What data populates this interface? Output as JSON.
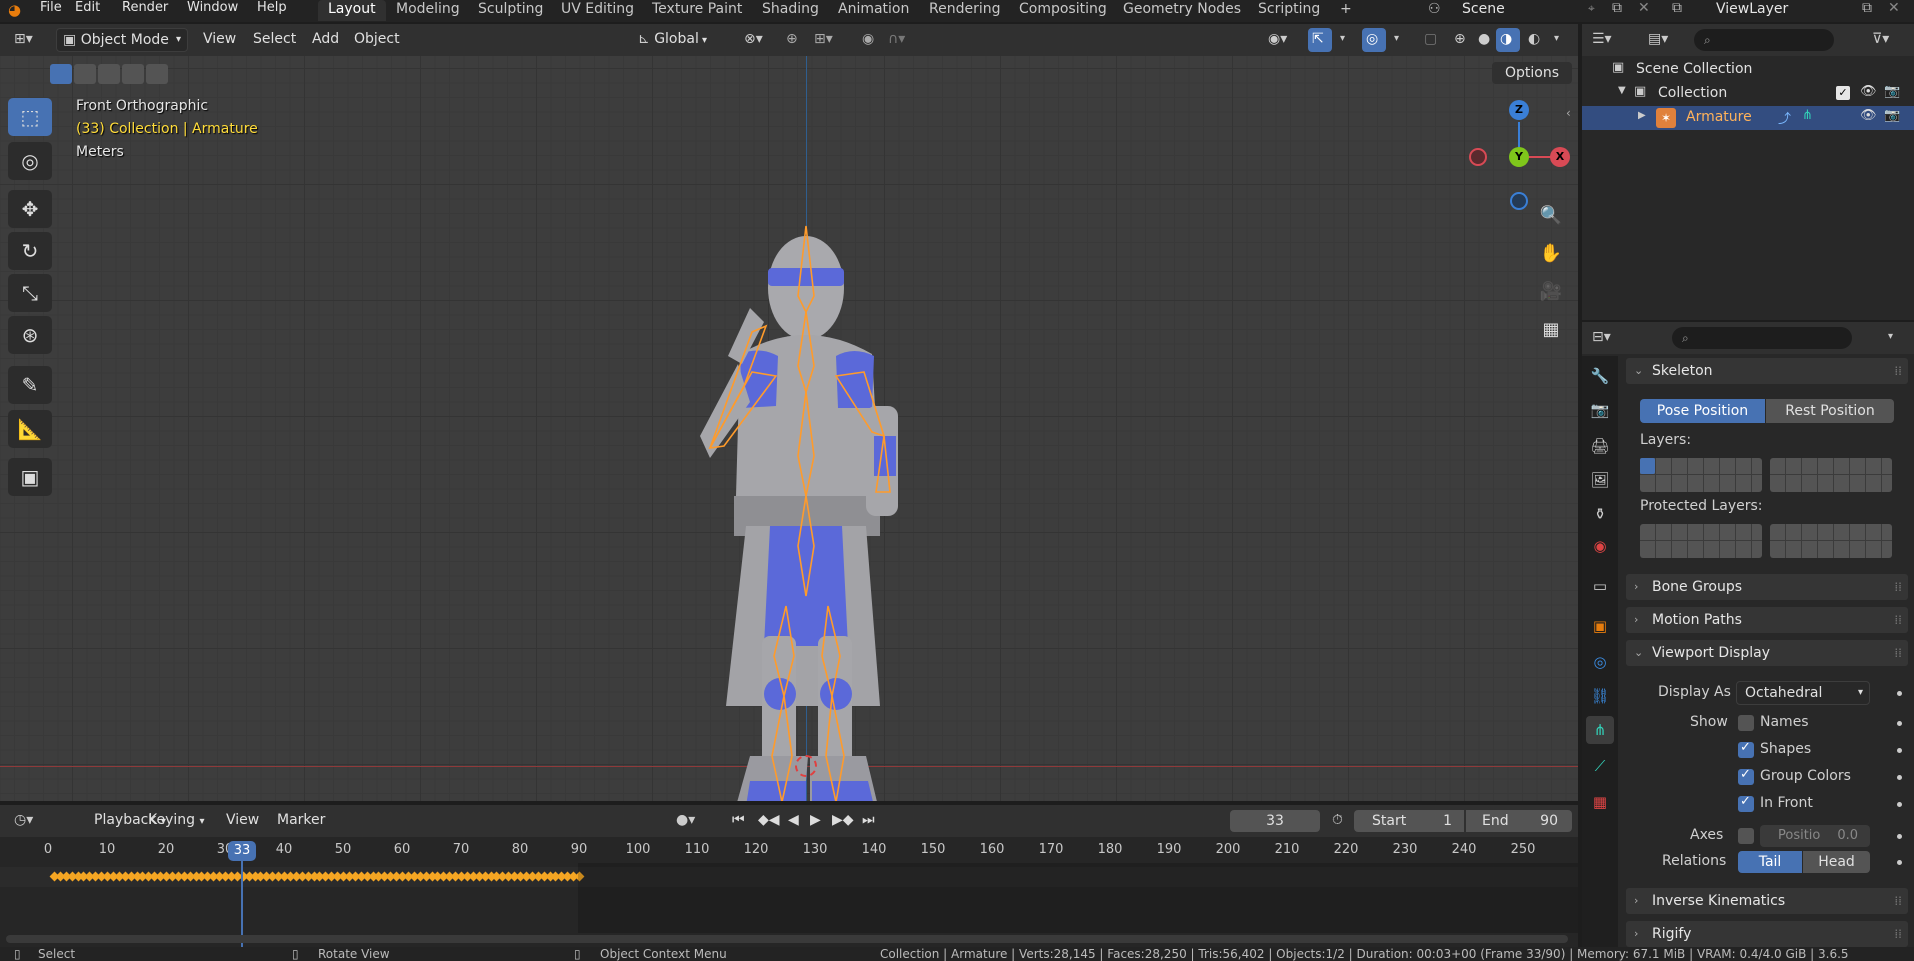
{
  "menus": [
    "File",
    "Edit",
    "Render",
    "Window",
    "Help"
  ],
  "workspaces": [
    "Layout",
    "Modeling",
    "Sculpting",
    "UV Editing",
    "Texture Paint",
    "Shading",
    "Animation",
    "Rendering",
    "Compositing",
    "Geometry Nodes",
    "Scripting",
    "+"
  ],
  "scene": {
    "label": "Scene",
    "view_layer": "ViewLayer"
  },
  "viewport_header": {
    "mode": "Object Mode",
    "menus": [
      "View",
      "Select",
      "Add",
      "Object"
    ],
    "orientation": "Global",
    "options": "Options"
  },
  "overlay": {
    "view_name": "Front Orthographic",
    "collection_info": "(33) Collection | Armature",
    "units": "Meters"
  },
  "gizmo": {
    "z": "Z",
    "y": "Y",
    "x": "X"
  },
  "outliner": {
    "scene_collection": "Scene Collection",
    "collection": "Collection",
    "armature": "Armature"
  },
  "properties": {
    "skeleton": "Skeleton",
    "pose_position": "Pose Position",
    "rest_position": "Rest Position",
    "layers": "Layers:",
    "protected_layers": "Protected Layers:",
    "bone_groups": "Bone Groups",
    "motion_paths": "Motion Paths",
    "viewport_display": "Viewport Display",
    "display_as_label": "Display As",
    "display_as_value": "Octahedral",
    "show_label": "Show",
    "names": "Names",
    "shapes": "Shapes",
    "group_colors": "Group Colors",
    "in_front": "In Front",
    "axes_label": "Axes",
    "axes_position": "Positio",
    "axes_value": "0.0",
    "relations_label": "Relations",
    "tail": "Tail",
    "head": "Head",
    "inverse_kinematics": "Inverse Kinematics",
    "rigify": "Rigify"
  },
  "timeline": {
    "menus": [
      "Playback",
      "Keying",
      "View",
      "Marker"
    ],
    "current_frame": "33",
    "start_label": "Start",
    "start": "1",
    "end_label": "End",
    "end": "90",
    "ticks": [
      "0",
      "10",
      "20",
      "30",
      "40",
      "50",
      "60",
      "70",
      "80",
      "90",
      "100",
      "110",
      "120",
      "130",
      "140",
      "150",
      "160",
      "170",
      "180",
      "190",
      "200",
      "210",
      "220",
      "230",
      "240",
      "250"
    ],
    "playhead": "33"
  },
  "status": {
    "select": "Select",
    "rotate": "Rotate View",
    "context": "Object Context Menu",
    "stats": "Collection | Armature | Verts:28,145 | Faces:28,250 | Tris:56,402 | Objects:1/2 | Duration: 00:03+00 (Frame 33/90) | Memory: 67.1 MiB | VRAM: 0.4/4.0 GiB | 3.6.5"
  }
}
